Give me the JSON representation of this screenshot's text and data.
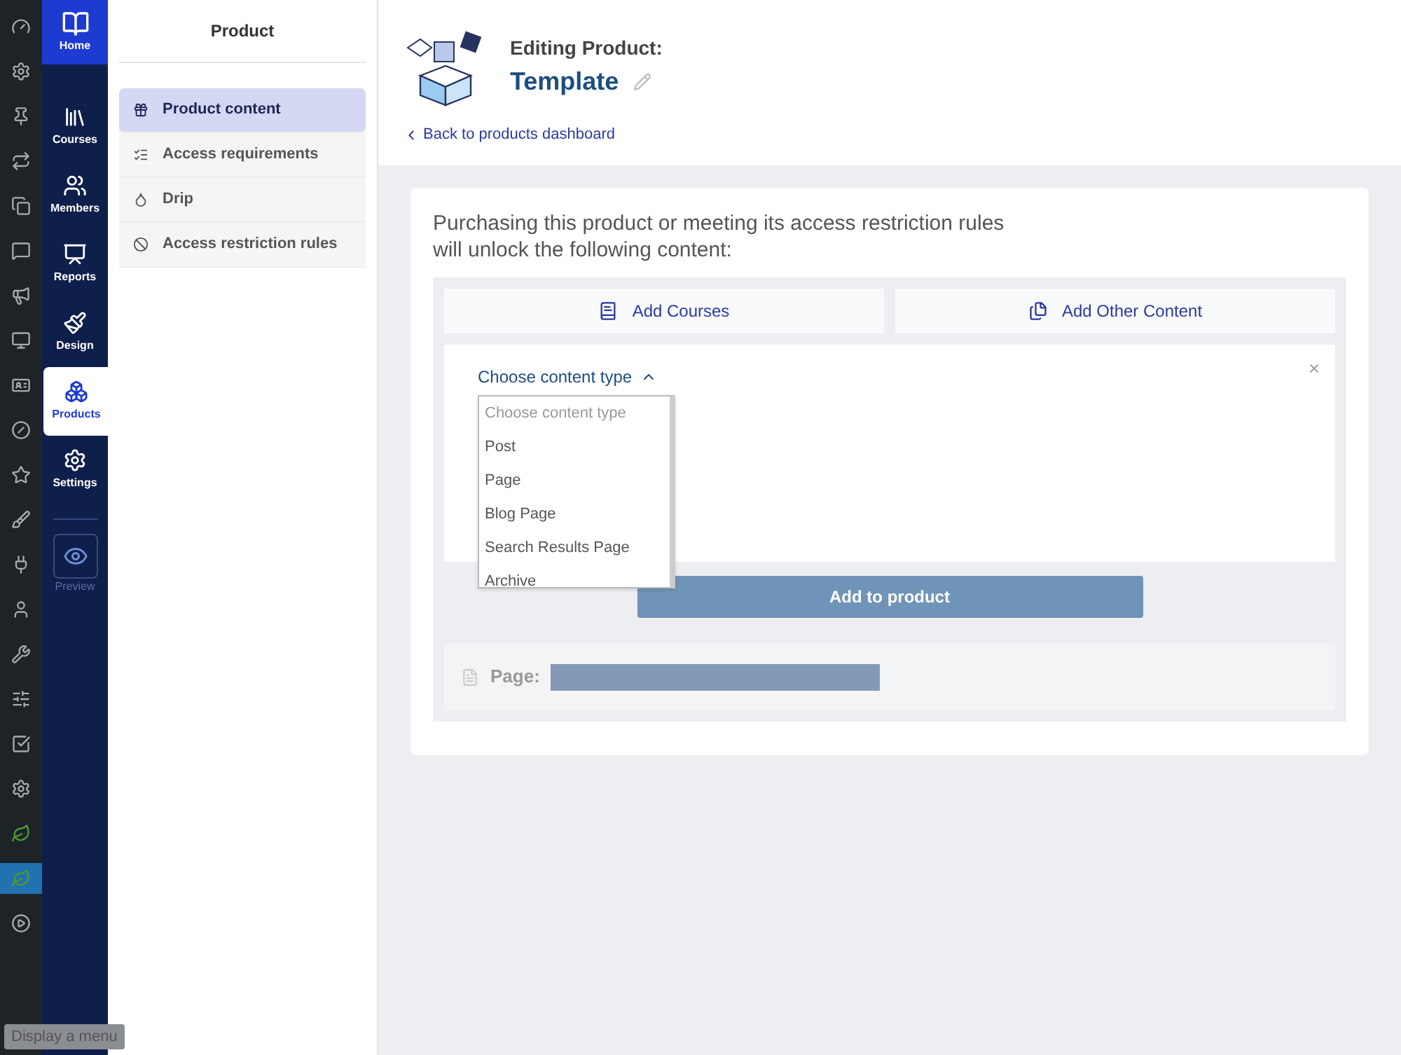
{
  "admin_menu": [
    {
      "selected": false
    },
    {
      "selected": false
    },
    {
      "selected": false
    },
    {
      "selected": false
    },
    {
      "selected": false
    },
    {
      "selected": false
    },
    {
      "selected": false
    },
    {
      "selected": false
    },
    {
      "selected": false
    },
    {
      "selected": false
    },
    {
      "selected": false
    },
    {
      "selected": false
    },
    {
      "selected": false
    },
    {
      "selected": false
    },
    {
      "selected": false
    },
    {
      "selected": false
    },
    {
      "selected": false
    },
    {
      "selected": false
    },
    {
      "selected": false
    },
    {
      "selected": true
    },
    {
      "selected": false
    }
  ],
  "tooltip": "Display a menu",
  "nav": {
    "home": "Home",
    "items": [
      {
        "label": "Courses",
        "selected": false
      },
      {
        "label": "Members",
        "selected": false
      },
      {
        "label": "Reports",
        "selected": false
      },
      {
        "label": "Design",
        "selected": false
      },
      {
        "label": "Products",
        "selected": true
      },
      {
        "label": "Settings",
        "selected": false
      }
    ],
    "preview": "Preview"
  },
  "product_panel": {
    "title": "Product",
    "items": [
      {
        "label": "Product content",
        "selected": true
      },
      {
        "label": "Access requirements",
        "selected": false
      },
      {
        "label": "Drip",
        "selected": false
      },
      {
        "label": "Access restriction rules",
        "selected": false
      }
    ]
  },
  "header": {
    "subtitle": "Editing Product:",
    "title": "Template",
    "back_link": "Back to products dashboard"
  },
  "content": {
    "intro": "Purchasing this product or meeting its access restriction rules will unlock the following content:",
    "buttons": [
      "Add Courses",
      "Add Other Content"
    ],
    "selector": {
      "label": "Choose content type",
      "expanded": true,
      "options": [
        {
          "label": "Choose content type",
          "selected": true
        },
        {
          "label": "Post",
          "selected": false
        },
        {
          "label": "Page",
          "selected": false
        },
        {
          "label": "Blog Page",
          "selected": false
        },
        {
          "label": "Search Results Page",
          "selected": false
        },
        {
          "label": "Archive",
          "selected": false
        }
      ]
    },
    "add_button": "Add to product",
    "item_label": "Page:"
  }
}
